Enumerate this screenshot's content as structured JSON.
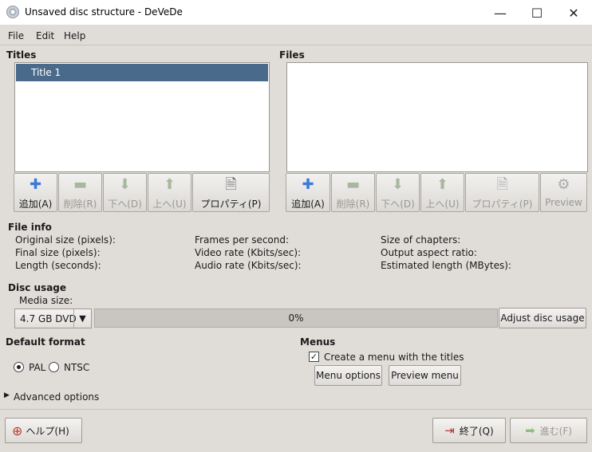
{
  "window": {
    "title": "Unsaved disc structure - DeVeDe",
    "minimize": "—",
    "maximize": "☐",
    "close": "✕"
  },
  "menubar": [
    {
      "label": "File"
    },
    {
      "label": "Edit"
    },
    {
      "label": "Help"
    }
  ],
  "titles": {
    "header": "Titles",
    "items": [
      "Title 1"
    ],
    "toolbar": [
      {
        "label": "追加(A)",
        "icon": "plus-icon",
        "enabled": true
      },
      {
        "label": "削除(R)",
        "icon": "minus-icon",
        "enabled": false
      },
      {
        "label": "下へ(D)",
        "icon": "arrow-down-icon",
        "enabled": false
      },
      {
        "label": "上へ(U)",
        "icon": "arrow-up-icon",
        "enabled": false
      },
      {
        "label": "プロパティ(P)",
        "icon": "properties-icon",
        "enabled": true
      }
    ]
  },
  "files": {
    "header": "Files",
    "toolbar": [
      {
        "label": "追加(A)",
        "icon": "plus-icon",
        "enabled": true
      },
      {
        "label": "削除(R)",
        "icon": "minus-icon",
        "enabled": false
      },
      {
        "label": "下へ(D)",
        "icon": "arrow-down-icon",
        "enabled": false
      },
      {
        "label": "上へ(U)",
        "icon": "arrow-up-icon",
        "enabled": false
      },
      {
        "label": "プロパティ(P)",
        "icon": "properties-icon",
        "enabled": false
      },
      {
        "label": "Preview",
        "icon": "preview-icon",
        "enabled": false
      }
    ]
  },
  "file_info": {
    "header": "File info",
    "col1": [
      "Original size (pixels):",
      "Final size (pixels):",
      "Length (seconds):"
    ],
    "col2": [
      "Frames per second:",
      "Video rate (Kbits/sec):",
      "Audio rate (Kbits/sec):"
    ],
    "col3": [
      "Size of chapters:",
      "Output aspect ratio:",
      "Estimated length (MBytes):"
    ]
  },
  "disc_usage": {
    "header": "Disc usage",
    "media_label": "Media size:",
    "media_value": "4.7 GB DVD",
    "progress_text": "0%",
    "progress": 0,
    "adjust_button": "Adjust disc usage"
  },
  "default_format": {
    "header": "Default format",
    "options": [
      "PAL",
      "NTSC"
    ],
    "selected": "PAL"
  },
  "menus": {
    "header": "Menus",
    "checkbox_label": "Create a menu with the titles",
    "checked": true,
    "options_button": "Menu options",
    "preview_button": "Preview menu"
  },
  "advanced": {
    "label": "Advanced options"
  },
  "bottom": {
    "help_button": "ヘルプ(H)",
    "quit_button": "終了(Q)",
    "forward_button": "進む(F)"
  },
  "colors": {
    "selection": "#4a6a8c",
    "background": "#e0ddd9"
  }
}
